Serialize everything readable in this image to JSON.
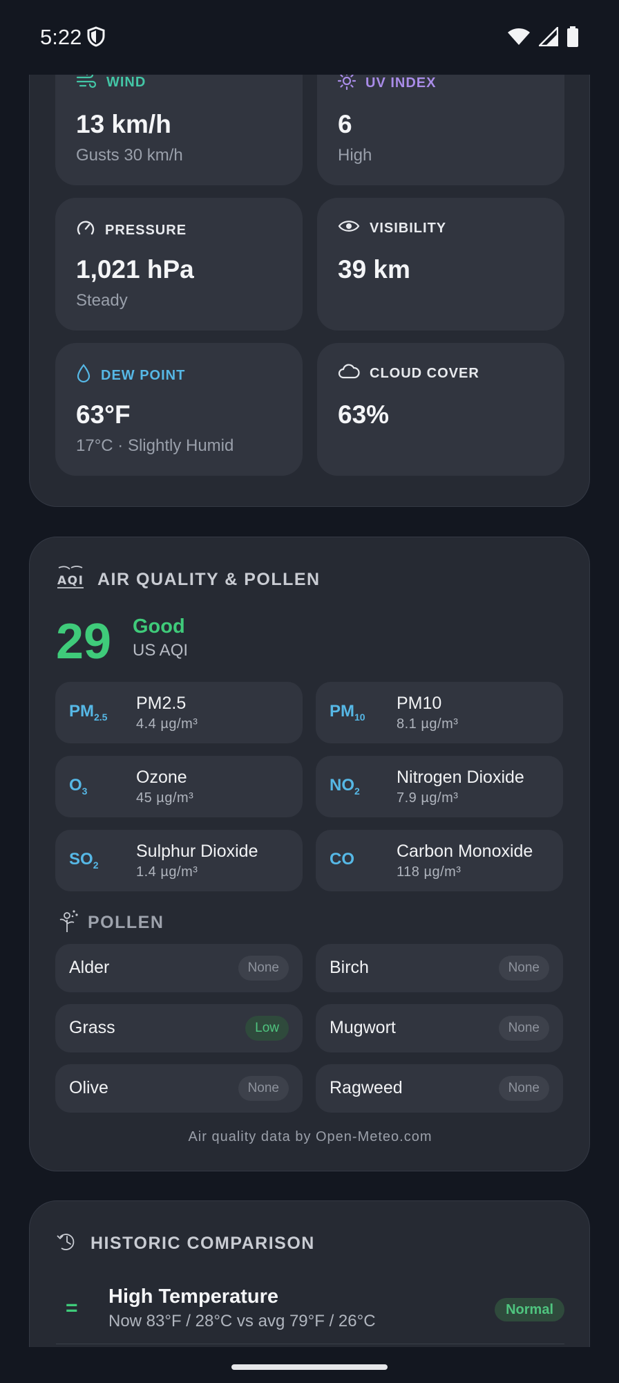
{
  "status": {
    "time": "5:22"
  },
  "conditions": {
    "wind": {
      "label": "WIND",
      "value": "13 km/h",
      "sub": "Gusts 30 km/h",
      "color": "#43c6a6"
    },
    "uv": {
      "label": "UV INDEX",
      "value": "6",
      "sub": "High",
      "color": "#a98ce8"
    },
    "pressure": {
      "label": "PRESSURE",
      "value": "1,021 hPa",
      "sub": "Steady"
    },
    "visibility": {
      "label": "VISIBILITY",
      "value": "39 km"
    },
    "dew_point": {
      "label": "DEW POINT",
      "value": "63°F",
      "sub": "17°C · Slightly Humid",
      "color": "#56b8e6"
    },
    "cloud_cover": {
      "label": "CLOUD COVER",
      "value": "63%"
    }
  },
  "air_quality": {
    "title": "AIR QUALITY & POLLEN",
    "aqi_value": "29",
    "aqi_label": "Good",
    "aqi_scale": "US AQI",
    "pollutants": [
      {
        "symbol": "PM",
        "sub": "2.5",
        "name": "PM2.5",
        "value": "4.4 µg/m³"
      },
      {
        "symbol": "PM",
        "sub": "10",
        "name": "PM10",
        "value": "8.1 µg/m³"
      },
      {
        "symbol": "O",
        "sub": "3",
        "name": "Ozone",
        "value": "45 µg/m³"
      },
      {
        "symbol": "NO",
        "sub": "2",
        "name": "Nitrogen Dioxide",
        "value": "7.9 µg/m³"
      },
      {
        "symbol": "SO",
        "sub": "2",
        "name": "Sulphur Dioxide",
        "value": "1.4 µg/m³"
      },
      {
        "symbol": "CO",
        "sub": "",
        "name": "Carbon Monoxide",
        "value": "118 µg/m³"
      }
    ],
    "pollen_title": "POLLEN",
    "pollen": [
      {
        "name": "Alder",
        "level": "None"
      },
      {
        "name": "Birch",
        "level": "None"
      },
      {
        "name": "Grass",
        "level": "Low"
      },
      {
        "name": "Mugwort",
        "level": "None"
      },
      {
        "name": "Olive",
        "level": "None"
      },
      {
        "name": "Ragweed",
        "level": "None"
      }
    ],
    "credit": "Air quality data by Open-Meteo.com"
  },
  "historic": {
    "title": "HISTORIC COMPARISON",
    "rows": [
      {
        "symbol": "=",
        "title": "High Temperature",
        "detail": "Now 83°F / 28°C vs avg 79°F / 26°C",
        "badge": "Normal"
      }
    ]
  }
}
